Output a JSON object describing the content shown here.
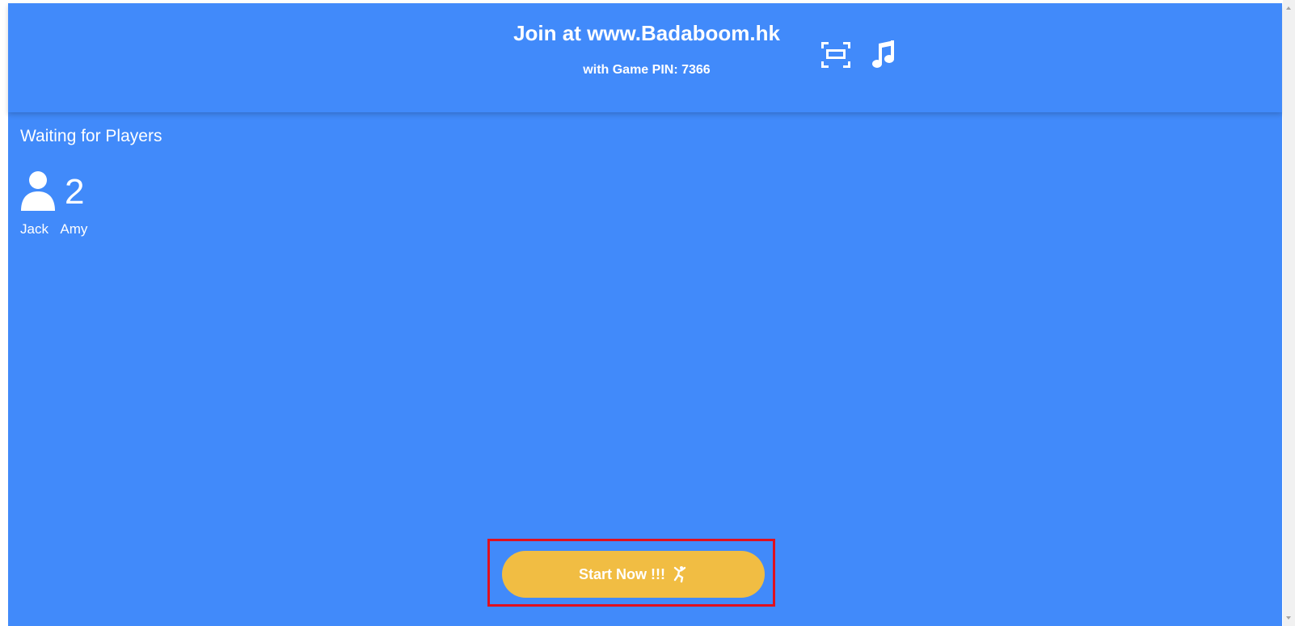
{
  "header": {
    "join_text": "Join at www.Badaboom.hk",
    "pin_text": "with Game PIN: 7366",
    "icons": [
      "fullscreen-icon",
      "music-note-icon"
    ]
  },
  "lobby": {
    "waiting_text": "Waiting for Players",
    "player_count": "2",
    "players": [
      "Jack",
      "Amy"
    ]
  },
  "start_button": {
    "label": "Start Now !!!",
    "icon": "dancing-figure-icon"
  },
  "colors": {
    "background": "#418afa",
    "button": "#f1bd43",
    "highlight": "#e0101e",
    "text": "#ffffff"
  }
}
